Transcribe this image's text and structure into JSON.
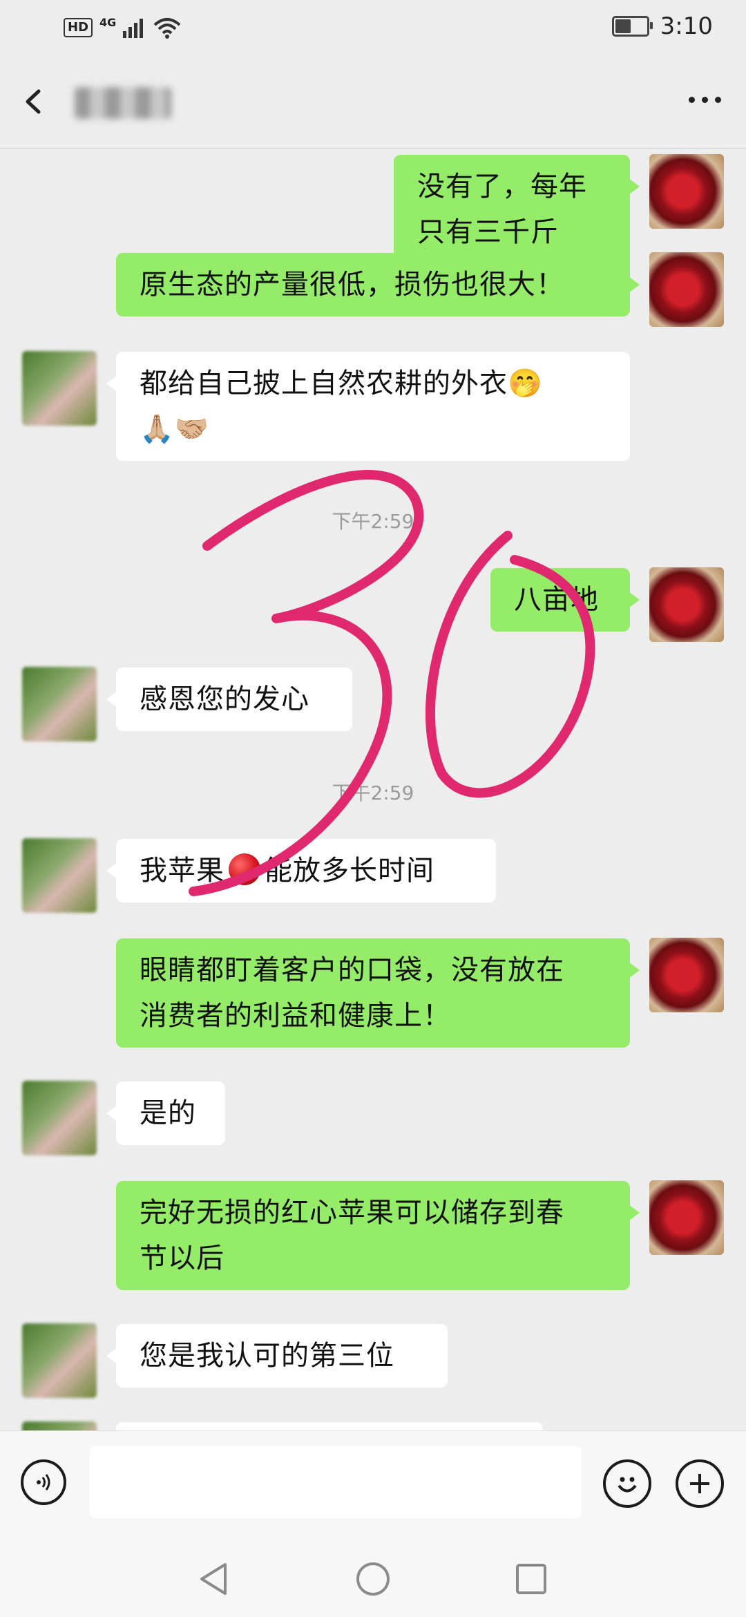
{
  "status_bar": {
    "hd_label": "HD",
    "network_label": "4G",
    "time": "3:10",
    "battery_level": 0.55
  },
  "title_bar": {
    "back_icon": "back-arrow-icon",
    "more_icon": "more-dots-icon"
  },
  "messages": [
    {
      "side": "self",
      "text": "没有了，每年只有三千斤"
    },
    {
      "side": "self",
      "text": "原生态的产量很低，损伤也很大！"
    },
    {
      "side": "other",
      "line1": "都给自己披上自然农耕的外衣🤭",
      "line2": "🙏🏼🤝🏼"
    },
    {
      "type": "timestamp",
      "text": "下午2:59"
    },
    {
      "side": "self",
      "text": "八亩地"
    },
    {
      "side": "other",
      "text": "感恩您的发心"
    },
    {
      "type": "timestamp",
      "text": "下午2:59"
    },
    {
      "side": "other",
      "before": "我苹果",
      "after": "能放多长时间",
      "inline_icon": "red-apple-emoji"
    },
    {
      "side": "self",
      "line1": "眼睛都盯着客户的口袋，没有放在",
      "line2": "消费者的利益和健康上！"
    },
    {
      "side": "other",
      "text": "是的"
    },
    {
      "side": "self",
      "line1": "完好无损的红心苹果可以储存到春",
      "line2": "节以后"
    },
    {
      "side": "other",
      "text": "您是我认可的第三位"
    }
  ],
  "input_bar": {
    "voice_icon": "voice-icon",
    "input_value": "",
    "emoji_icon": "smiley-icon",
    "plus_icon": "plus-icon"
  },
  "nav_bar": {
    "back_icon": "triangle-back-icon",
    "home_icon": "circle-home-icon",
    "recents_icon": "square-recents-icon"
  },
  "overlay": {
    "handwritten_text": "30",
    "color": "#e0286f"
  },
  "colors": {
    "self_bubble": "#95ec69",
    "other_bubble": "#ffffff",
    "background": "#ededed"
  }
}
